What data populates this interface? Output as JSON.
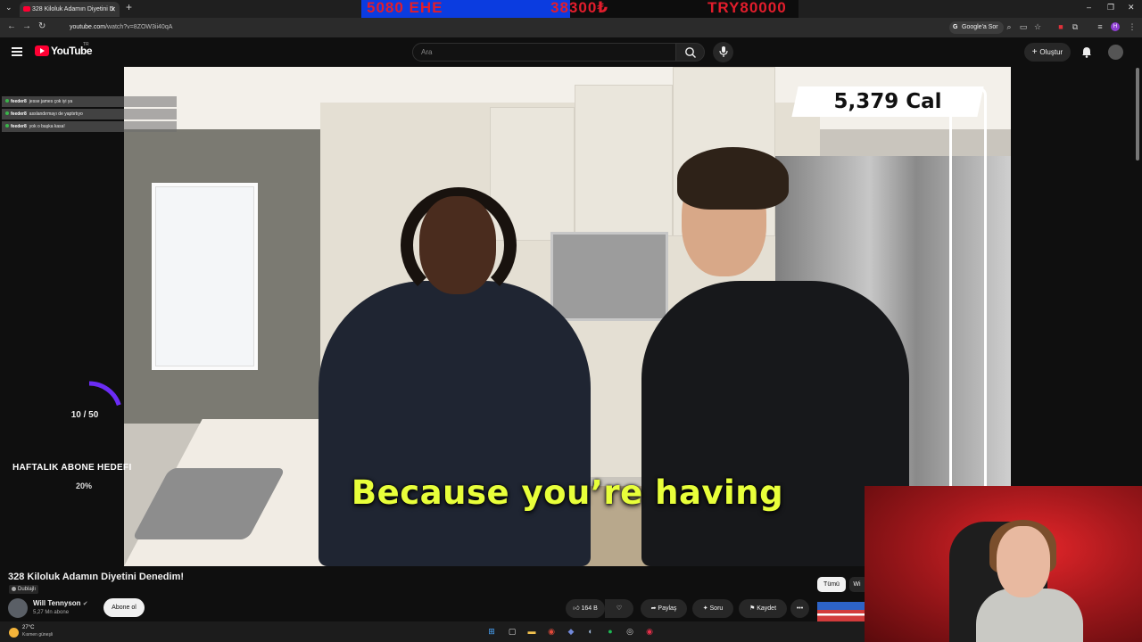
{
  "browser": {
    "tab_title": "328 Kiloluk Adamın Diyetini D",
    "url_domain": "youtube.com",
    "url_path": "/watch?v=8ZOW3ii40qA",
    "google_button": "Google'a Sor"
  },
  "ticker": {
    "item1": "5080 EHE",
    "item2": "38300₺",
    "item3": "TRY80000"
  },
  "youtube": {
    "logo_text": "YouTube",
    "country": "TR",
    "search_placeholder": "Ara",
    "create_label": "Oluştur"
  },
  "video": {
    "calories": "5,379 Cal",
    "subtitle": "Because you’re having",
    "title": "328 Kiloluk Adamın Diyetini Denedim!",
    "dubbed_label": "Dublajlı"
  },
  "chat": [
    {
      "user": "feeder8",
      "message": "jesse james çok iyi ya"
    },
    {
      "user": "feeder8",
      "message": "asslandırmayı de yaptırtıyo"
    },
    {
      "user": "feeder8",
      "message": "yok o başka kasa!"
    }
  ],
  "sub_goal": {
    "count": "10 / 50",
    "title": "HAFTALIK ABONE HEDEFI",
    "percent": "20%",
    "progress": 0.2
  },
  "channel": {
    "name": "Will Tennyson",
    "subscribers": "5,27 Mn abone",
    "subscribe_label": "Abone ol"
  },
  "actions": {
    "likes": "164 B",
    "share": "Paylaş",
    "ask": "Soru",
    "save": "Kaydet"
  },
  "chips": {
    "all": "Tümü",
    "next": "Wi"
  },
  "taskbar": {
    "temperature": "27°C",
    "weather": "Kısmen güneşli"
  },
  "colors": {
    "youtube_red": "#ff0033",
    "subtitle": "#e8ff3a",
    "goal_arc": "#6b2cf5"
  }
}
